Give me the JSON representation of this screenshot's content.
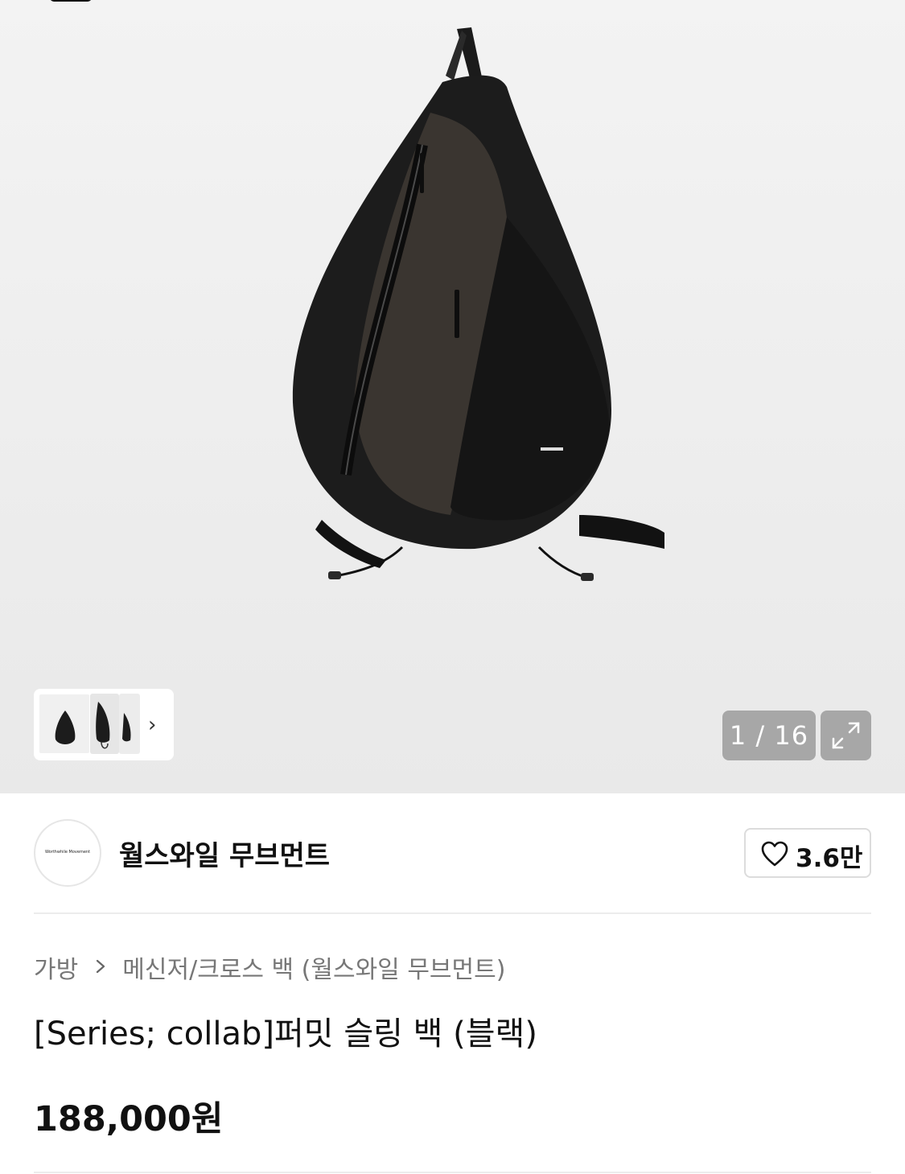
{
  "gallery": {
    "image_alt": "black sling bag",
    "counter_text": "1 / 16",
    "thumb_next_label": "›",
    "thumbnails": [
      "thumbnail-1",
      "thumbnail-2",
      "thumbnail-3"
    ],
    "expand_icon": "expand-icon"
  },
  "brand": {
    "logo_text": "Worthwhile Movement",
    "name": "월스와일 무브먼트",
    "like_icon": "heart-icon",
    "like_count": "3.6만"
  },
  "breadcrumb": {
    "items": [
      "가방",
      "메신저/크로스 백 (월스와일 무브먼트)"
    ],
    "separator_icon": "chevron-right-icon"
  },
  "product": {
    "title": "[Series; collab]퍼밋 슬링 백 (블랙)",
    "price": "188,000원"
  }
}
